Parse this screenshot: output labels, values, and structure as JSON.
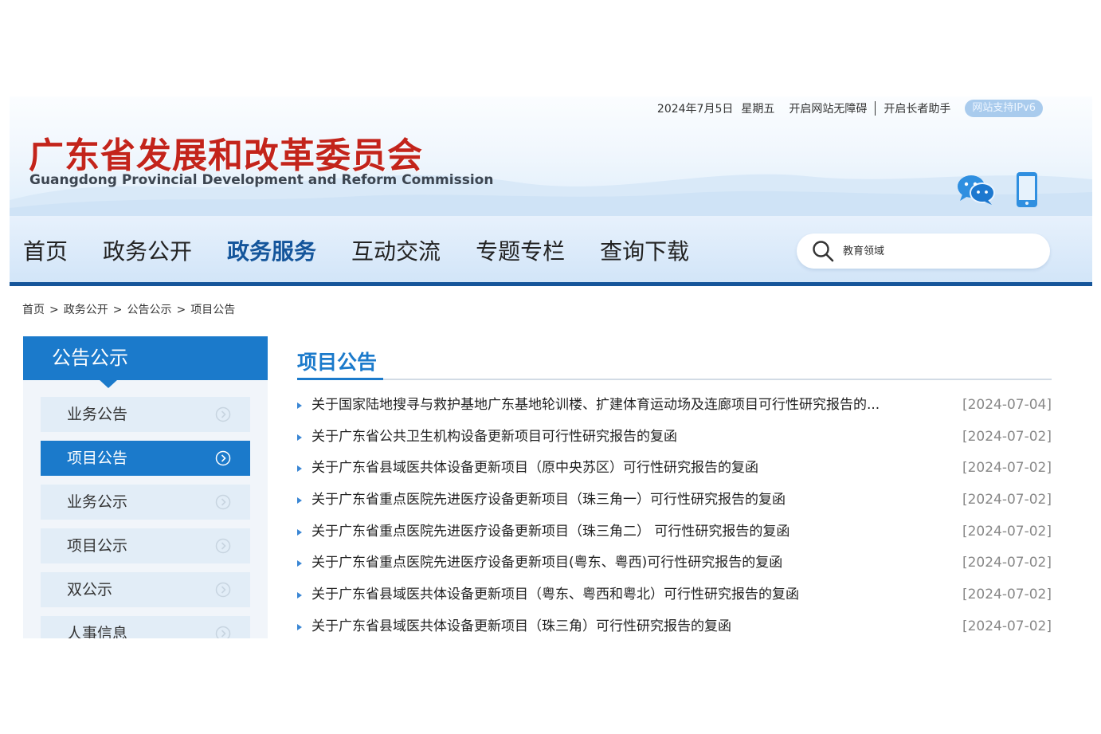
{
  "header": {
    "date": "2024年7月5日",
    "weekday": "星期五",
    "accessibility_link": "开启网站无障碍",
    "elder_link": "开启长者助手",
    "ipv6_badge": "网站支持IPv6",
    "site_title": "广东省发展和改革委员会",
    "site_subtitle": "Guangdong Provincial Development and Reform Commission",
    "icons": [
      "wechat-icon",
      "mobile-icon"
    ]
  },
  "nav": {
    "items": [
      {
        "label": "首页"
      },
      {
        "label": "政务公开"
      },
      {
        "label": "政务服务",
        "active": true
      },
      {
        "label": "互动交流"
      },
      {
        "label": "专题专栏"
      },
      {
        "label": "查询下载"
      }
    ],
    "search_placeholder": "教育领域"
  },
  "breadcrumb": [
    "首页",
    "政务公开",
    "公告公示",
    "项目公告"
  ],
  "sidebar": {
    "title": "公告公示",
    "items": [
      {
        "label": "业务公告"
      },
      {
        "label": "项目公告",
        "active": true
      },
      {
        "label": "业务公示"
      },
      {
        "label": "项目公示"
      },
      {
        "label": "双公示"
      },
      {
        "label": "人事信息"
      }
    ]
  },
  "main": {
    "title": "项目公告",
    "news": [
      {
        "title": "关于国家陆地搜寻与救护基地广东基地轮训楼、扩建体育运动场及连廊项目可行性研究报告的...",
        "date": "[2024-07-04]"
      },
      {
        "title": "关于广东省公共卫生机构设备更新项目可行性研究报告的复函",
        "date": "[2024-07-02]"
      },
      {
        "title": "关于广东省县域医共体设备更新项目（原中央苏区）可行性研究报告的复函",
        "date": "[2024-07-02]"
      },
      {
        "title": "关于广东省重点医院先进医疗设备更新项目（珠三角一）可行性研究报告的复函",
        "date": "[2024-07-02]"
      },
      {
        "title": "关于广东省重点医院先进医疗设备更新项目（珠三角二） 可行性研究报告的复函",
        "date": "[2024-07-02]"
      },
      {
        "title": "关于广东省重点医院先进医疗设备更新项目(粤东、粤西)可行性研究报告的复函",
        "date": "[2024-07-02]"
      },
      {
        "title": "关于广东省县域医共体设备更新项目（粤东、粤西和粤北）可行性研究报告的复函",
        "date": "[2024-07-02]"
      },
      {
        "title": "关于广东省县域医共体设备更新项目（珠三角）可行性研究报告的复函",
        "date": "[2024-07-02]"
      }
    ]
  },
  "colors": {
    "brand_red": "#c3241b",
    "primary_blue": "#1b7acb",
    "nav_active": "#14559b",
    "nav_border": "#15559a"
  }
}
